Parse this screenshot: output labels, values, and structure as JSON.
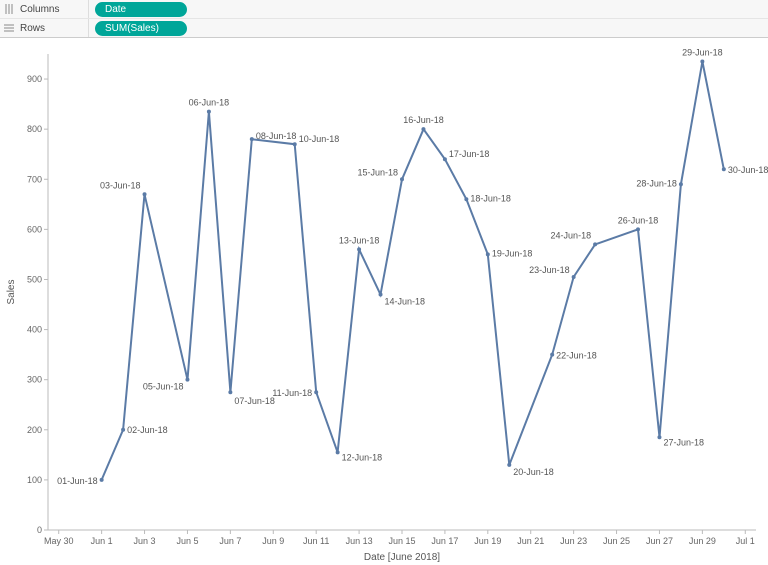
{
  "shelves": {
    "columns_label": "Columns",
    "rows_label": "Rows",
    "columns_pill": "Date",
    "rows_pill": "SUM(Sales)"
  },
  "chart_data": {
    "type": "line",
    "title": "",
    "xlabel": "Date [June 2018]",
    "ylabel": "Sales",
    "ylim": [
      0,
      950
    ],
    "y_ticks": [
      0,
      100,
      200,
      300,
      400,
      500,
      600,
      700,
      800,
      900
    ],
    "x_tick_labels": [
      "May 30",
      "Jun 1",
      "Jun 3",
      "Jun 5",
      "Jun 7",
      "Jun 9",
      "Jun 11",
      "Jun 13",
      "Jun 15",
      "Jun 17",
      "Jun 19",
      "Jun 21",
      "Jun 23",
      "Jun 25",
      "Jun 27",
      "Jun 29",
      "Jul 1"
    ],
    "x_tick_days": [
      -1,
      1,
      3,
      5,
      7,
      9,
      11,
      13,
      15,
      17,
      19,
      21,
      23,
      25,
      27,
      29,
      31
    ],
    "points": [
      {
        "day": 1,
        "label": "01-Jun-18",
        "value": 100
      },
      {
        "day": 2,
        "label": "02-Jun-18",
        "value": 200
      },
      {
        "day": 3,
        "label": "03-Jun-18",
        "value": 670
      },
      {
        "day": 5,
        "label": "05-Jun-18",
        "value": 300
      },
      {
        "day": 6,
        "label": "06-Jun-18",
        "value": 835
      },
      {
        "day": 7,
        "label": "07-Jun-18",
        "value": 275
      },
      {
        "day": 8,
        "label": "08-Jun-18",
        "value": 780
      },
      {
        "day": 10,
        "label": "10-Jun-18",
        "value": 770
      },
      {
        "day": 11,
        "label": "11-Jun-18",
        "value": 275
      },
      {
        "day": 12,
        "label": "12-Jun-18",
        "value": 155
      },
      {
        "day": 13,
        "label": "13-Jun-18",
        "value": 560
      },
      {
        "day": 14,
        "label": "14-Jun-18",
        "value": 470
      },
      {
        "day": 15,
        "label": "15-Jun-18",
        "value": 700
      },
      {
        "day": 16,
        "label": "16-Jun-18",
        "value": 800
      },
      {
        "day": 17,
        "label": "17-Jun-18",
        "value": 740
      },
      {
        "day": 18,
        "label": "18-Jun-18",
        "value": 660
      },
      {
        "day": 19,
        "label": "19-Jun-18",
        "value": 550
      },
      {
        "day": 20,
        "label": "20-Jun-18",
        "value": 130
      },
      {
        "day": 22,
        "label": "22-Jun-18",
        "value": 350
      },
      {
        "day": 23,
        "label": "23-Jun-18",
        "value": 505
      },
      {
        "day": 24,
        "label": "24-Jun-18",
        "value": 570
      },
      {
        "day": 26,
        "label": "26-Jun-18",
        "value": 600
      },
      {
        "day": 27,
        "label": "27-Jun-18",
        "value": 185
      },
      {
        "day": 28,
        "label": "28-Jun-18",
        "value": 690
      },
      {
        "day": 29,
        "label": "29-Jun-18",
        "value": 935
      },
      {
        "day": 30,
        "label": "30-Jun-18",
        "value": 720
      }
    ],
    "label_offsets": {
      "1": {
        "dx": -44,
        "dy": 4
      },
      "2": {
        "dx": 6,
        "dy": 3
      },
      "3": {
        "dx": -44,
        "dy": -6
      },
      "5": {
        "dx": -44,
        "dy": 10
      },
      "6": {
        "dx": -22,
        "dy": -6
      },
      "7": {
        "dx": 2,
        "dy": 12
      },
      "8": {
        "dx": 6,
        "dy": 0
      },
      "10": {
        "dx": 6,
        "dy": -2
      },
      "11": {
        "dx": -44,
        "dy": 4
      },
      "12": {
        "dx": 6,
        "dy": 8
      },
      "13": {
        "dx": -22,
        "dy": -6
      },
      "14": {
        "dx": 6,
        "dy": 10
      },
      "15": {
        "dx": -44,
        "dy": -4
      },
      "16": {
        "dx": -22,
        "dy": -6
      },
      "17": {
        "dx": 6,
        "dy": -2
      },
      "18": {
        "dx": 6,
        "dy": 2
      },
      "19": {
        "dx": 6,
        "dy": 2
      },
      "20": {
        "dx": 6,
        "dy": 10
      },
      "22": {
        "dx": 6,
        "dy": 4
      },
      "23": {
        "dx": -44,
        "dy": -4
      },
      "24": {
        "dx": -44,
        "dy": -6
      },
      "26": {
        "dx": -8,
        "dy": -6
      },
      "27": {
        "dx": 6,
        "dy": 8
      },
      "28": {
        "dx": -44,
        "dy": 2
      },
      "29": {
        "dx": -22,
        "dy": -6
      },
      "30": {
        "dx": 6,
        "dy": 4
      }
    }
  }
}
